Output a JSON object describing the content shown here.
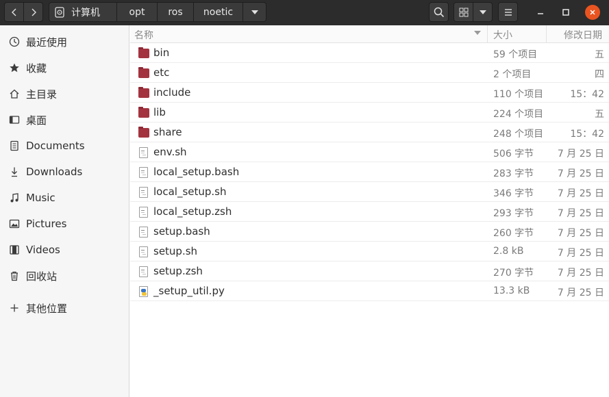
{
  "header": {
    "breadcrumbs": [
      "计算机",
      "opt",
      "ros",
      "noetic"
    ],
    "icons": {
      "back": "chevron-left-icon",
      "forward": "chevron-right-icon",
      "drive": "drive-icon",
      "search": "search-icon",
      "view": "grid-icon",
      "menu": "hamburger-icon"
    },
    "close_color": "#e95420"
  },
  "sidebar": {
    "items": [
      {
        "label": "最近使用",
        "icon": "clock-icon"
      },
      {
        "label": "收藏",
        "icon": "star-icon"
      },
      {
        "label": "主目录",
        "icon": "home-icon"
      },
      {
        "label": "桌面",
        "icon": "desktop-icon"
      },
      {
        "label": "Documents",
        "icon": "document-icon"
      },
      {
        "label": "Downloads",
        "icon": "download-icon"
      },
      {
        "label": "Music",
        "icon": "music-icon"
      },
      {
        "label": "Pictures",
        "icon": "picture-icon"
      },
      {
        "label": "Videos",
        "icon": "video-icon"
      },
      {
        "label": "回收站",
        "icon": "trash-icon"
      },
      {
        "label": "其他位置",
        "icon": "plus-icon"
      }
    ]
  },
  "columns": {
    "name": "名称",
    "size": "大小",
    "modified": "修改日期"
  },
  "files": [
    {
      "name": "bin",
      "type": "folder",
      "size": "59 个项目",
      "modified": "五"
    },
    {
      "name": "etc",
      "type": "folder",
      "size": "2 个项目",
      "modified": "四"
    },
    {
      "name": "include",
      "type": "folder",
      "size": "110 个项目",
      "modified": "15：42"
    },
    {
      "name": "lib",
      "type": "folder",
      "size": "224 个项目",
      "modified": "五"
    },
    {
      "name": "share",
      "type": "folder",
      "size": "248 个项目",
      "modified": "15：42"
    },
    {
      "name": "env.sh",
      "type": "text",
      "size": "506 字节",
      "modified": "7 月 25 日"
    },
    {
      "name": "local_setup.bash",
      "type": "text",
      "size": "283 字节",
      "modified": "7 月 25 日"
    },
    {
      "name": "local_setup.sh",
      "type": "text",
      "size": "346 字节",
      "modified": "7 月 25 日"
    },
    {
      "name": "local_setup.zsh",
      "type": "text",
      "size": "293 字节",
      "modified": "7 月 25 日"
    },
    {
      "name": "setup.bash",
      "type": "text",
      "size": "260 字节",
      "modified": "7 月 25 日"
    },
    {
      "name": "setup.sh",
      "type": "text",
      "size": "2.8 kB",
      "modified": "7 月 25 日"
    },
    {
      "name": "setup.zsh",
      "type": "text",
      "size": "270 字节",
      "modified": "7 月 25 日"
    },
    {
      "name": "_setup_util.py",
      "type": "python",
      "size": "13.3 kB",
      "modified": "7 月 25 日"
    }
  ]
}
